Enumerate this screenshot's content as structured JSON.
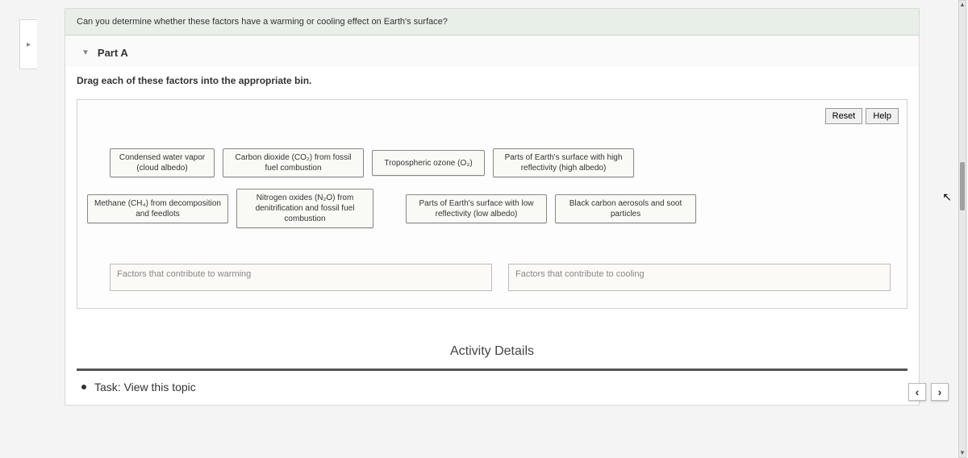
{
  "question": "Can you determine whether these factors have a warming or cooling effect on Earth's surface?",
  "part": {
    "label": "Part A"
  },
  "instructions": "Drag each of these factors into the appropriate bin.",
  "buttons": {
    "reset": "Reset",
    "help": "Help"
  },
  "cards": {
    "row1": [
      "Condensed water vapor (cloud albedo)",
      "Carbon dioxide (CO₂) from fossil fuel combustion",
      "Tropospheric ozone (O₃)",
      "Parts of Earth's surface with high reflectivity (high albedo)"
    ],
    "row2": [
      "Methane (CH₄) from decomposition and feedlots",
      "Nitrogen oxides (N₂O) from denitrification and fossil fuel combustion",
      "Parts of Earth's surface with low reflectivity (low albedo)",
      "Black carbon aerosols and soot particles"
    ]
  },
  "bins": {
    "warming": "Factors that contribute to warming",
    "cooling": "Factors that contribute to cooling"
  },
  "details_header": "Activity Details",
  "task": "Task: View this topic",
  "nav": {
    "prev": "‹",
    "next": "›"
  }
}
